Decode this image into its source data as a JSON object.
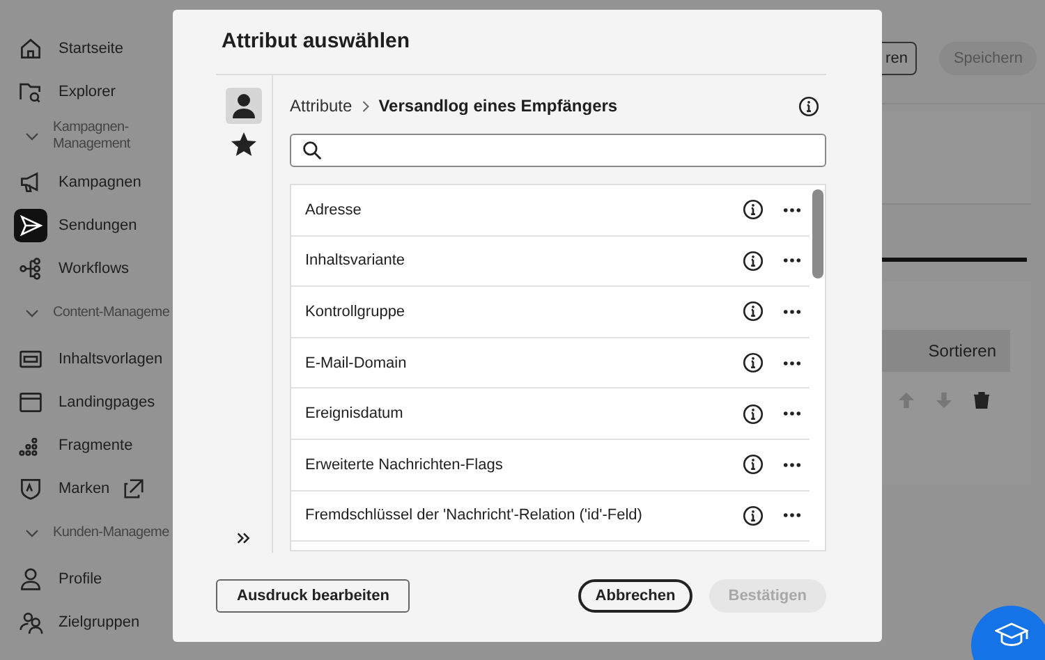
{
  "sidebar": {
    "items": [
      {
        "kind": "item",
        "label": "Startseite",
        "selected": false
      },
      {
        "kind": "item",
        "label": "Explorer",
        "selected": false
      },
      {
        "kind": "group",
        "label": "Kampagnen-Management",
        "expanded": true
      },
      {
        "kind": "item",
        "label": "Kampagnen",
        "selected": false
      },
      {
        "kind": "item",
        "label": "Sendungen",
        "selected": true
      },
      {
        "kind": "item",
        "label": "Workflows",
        "selected": false
      },
      {
        "kind": "group",
        "label": "Content-Manageme",
        "expanded": true
      },
      {
        "kind": "item",
        "label": "Inhaltsvorlagen",
        "selected": false
      },
      {
        "kind": "item",
        "label": "Landingpages",
        "selected": false
      },
      {
        "kind": "item",
        "label": "Fragmente",
        "selected": false
      },
      {
        "kind": "external-item",
        "label": "Marken",
        "selected": false
      },
      {
        "kind": "group",
        "label": "Kunden-Manageme",
        "expanded": true
      },
      {
        "kind": "item",
        "label": "Profile",
        "selected": false
      },
      {
        "kind": "item",
        "label": "Zielgruppen",
        "selected": false
      }
    ]
  },
  "header": {
    "buttons": [
      {
        "label": "ren",
        "disabled": false
      },
      {
        "label": "Speichern",
        "disabled": true
      }
    ]
  },
  "background_table": {
    "column": "Sortieren"
  },
  "dialog": {
    "title": "Attribut auswählen",
    "rail_tabs": [
      {
        "selected": true
      },
      {
        "selected": false
      }
    ],
    "breadcrumb": [
      "Attribute",
      "Versandlog eines Empfängers"
    ],
    "attributes": [
      "Adresse",
      "Inhaltsvariante",
      "Kontrollgruppe",
      "E-Mail-Domain",
      "Ereignisdatum",
      "Erweiterte Nachrichten-Flags",
      "Fremdschlüssel der 'Nachricht'-Relation ('id'-Feld)"
    ],
    "buttons": [
      {
        "label": "Ausdruck bearbeiten",
        "kind": "secondary",
        "disabled": false
      },
      {
        "label": "Abbrechen",
        "kind": "outline",
        "disabled": false
      },
      {
        "label": "Bestätigen",
        "kind": "primary",
        "disabled": true
      }
    ]
  }
}
